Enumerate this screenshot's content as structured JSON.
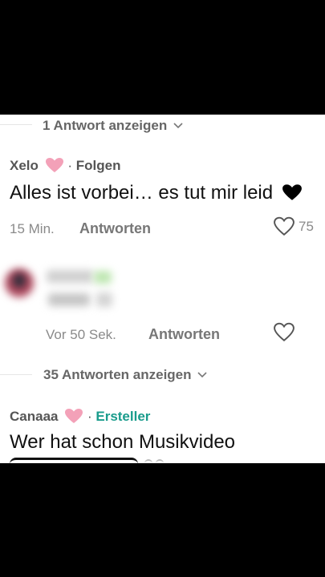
{
  "thread": {
    "show_replies_top": "1 Antwort anzeigen",
    "show_replies_mid": "35 Antworten anzeigen"
  },
  "comments": [
    {
      "username": "Xelo",
      "separator": "·",
      "follow_label": "Folgen",
      "text": "Alles ist vorbei… es tut mir leid",
      "time": "15 Min.",
      "reply_label": "Antworten",
      "likes": "75"
    },
    {
      "time": "Vor 50 Sek.",
      "reply_label": "Antworten"
    },
    {
      "username": "Canaaa",
      "separator": "·",
      "creator_label": "Ersteller",
      "text": "Wer hat schon Musikvideo"
    }
  ],
  "colors": {
    "creator": "#1a9c8c",
    "heart_emoji": "#f3a1b8"
  }
}
